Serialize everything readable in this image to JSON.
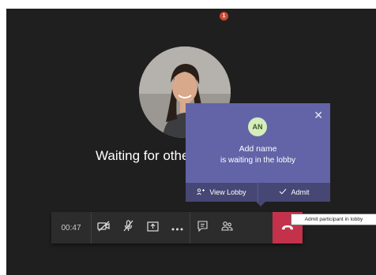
{
  "stage": {
    "waiting_text": "Waiting for others to join..."
  },
  "popup": {
    "avatar_initials": "AN",
    "title": "Add name",
    "subtitle": "is waiting in the lobby",
    "view_lobby_label": "View Lobby",
    "admit_label": "Admit"
  },
  "toolbar": {
    "timer": "00:47",
    "participants_badge": "1",
    "icons": [
      "camera-off-icon",
      "mic-off-icon",
      "share-tray-icon",
      "more-options-icon",
      "chat-icon",
      "participants-icon",
      "hang-up-icon"
    ]
  },
  "tooltip": {
    "text": "Admit participant in lobby"
  },
  "colors": {
    "stage_bg": "#1f1f1f",
    "popup_bg": "#6264a7",
    "popup_footer": "#464775",
    "toolbar_bg": "#2d2c2c",
    "hangup": "#c4314b",
    "badge": "#cc4a31"
  }
}
